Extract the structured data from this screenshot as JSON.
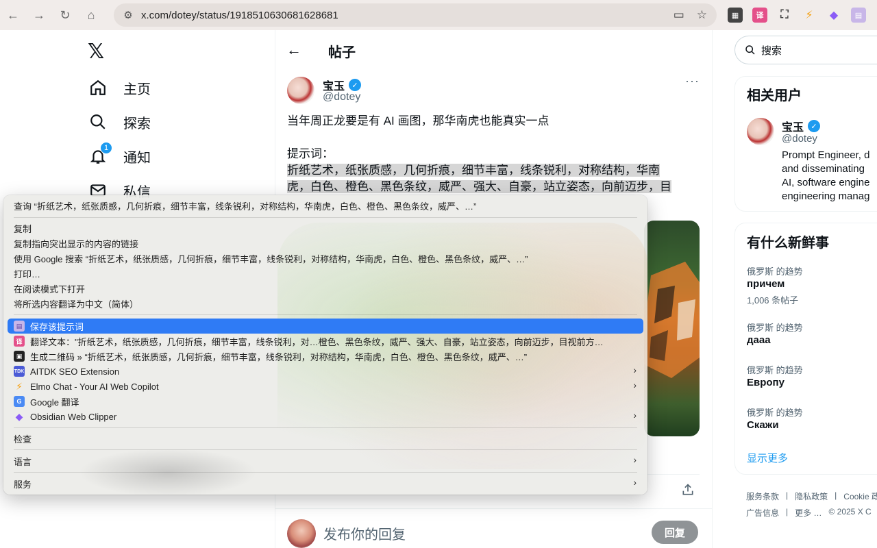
{
  "browser": {
    "url": "x.com/dotey/status/1918510630681628681"
  },
  "left_nav": {
    "items": [
      {
        "label": "主页"
      },
      {
        "label": "探索"
      },
      {
        "label": "通知",
        "badge": "1"
      },
      {
        "label": "私信"
      }
    ]
  },
  "post": {
    "header_title": "帖子",
    "author_name": "宝玉",
    "author_handle": "@dotey",
    "text_line1": "当年周正龙要是有 AI 画图，那华南虎也能真实一点",
    "text_line2": "提示词：",
    "text_highlight1": "折纸艺术，纸张质感，几何折痕，细节丰富，线条锐利，对称结构，华南",
    "text_highlight2": "虎，白色、橙色、黑色条纹，威严、强大、自豪，站立姿态，向前迈步，目",
    "reply_placeholder": "发布你的回复",
    "reply_button": "回复"
  },
  "sidebar": {
    "search_placeholder": "搜索",
    "related_title": "相关用户",
    "related_user": {
      "name": "宝玉",
      "handle": "@dotey",
      "bio": [
        "Prompt Engineer, d",
        "and disseminating",
        "AI, software engine",
        "engineering manag"
      ]
    },
    "trends_title": "有什么新鲜事",
    "trends": [
      {
        "category": "俄罗斯 的趋势",
        "name": "причем",
        "count": "1,006 条帖子"
      },
      {
        "category": "俄罗斯 的趋势",
        "name": "дааа"
      },
      {
        "category": "俄罗斯 的趋势",
        "name": "Европу"
      },
      {
        "category": "俄罗斯 的趋势",
        "name": "Скажи"
      }
    ],
    "show_more": "显示更多",
    "footer_row1": [
      "服务条款",
      "|",
      "隐私政策",
      "|",
      "Cookie 政"
    ],
    "footer_row2": [
      "广告信息",
      "|",
      "更多 …",
      "© 2025 X C"
    ]
  },
  "context_menu": {
    "items": [
      {
        "label": "查询 “折纸艺术，纸张质感，几何折痕，细节丰富，线条锐利，对称结构，华南虎，白色、橙色、黑色条纹，威严、…”"
      },
      {
        "label": "复制"
      },
      {
        "label": "复制指向突出显示的内容的链接"
      },
      {
        "label": "使用 Google 搜索 “折纸艺术，纸张质感，几何折痕，细节丰富，线条锐利，对称结构，华南虎，白色、橙色、黑色条纹，威严、…”"
      },
      {
        "label": "打印…"
      },
      {
        "label": "在阅读模式下打开"
      },
      {
        "label": "将所选内容翻译为中文（简体）"
      },
      {
        "label": "保存该提示词"
      },
      {
        "label": "翻译文本：\"折纸艺术，纸张质感，几何折痕，细节丰富，线条锐利，对…橙色、黑色条纹，威严、强大、自豪，站立姿态，向前迈步，目视前方…"
      },
      {
        "label": "生成二维码 » “折纸艺术，纸张质感，几何折痕，细节丰富，线条锐利，对称结构，华南虎，白色、橙色、黑色条纹，威严、…”"
      },
      {
        "label": "AITDK SEO Extension"
      },
      {
        "label": "Elmo Chat - Your AI Web Copilot"
      },
      {
        "label": "Google 翻译"
      },
      {
        "label": "Obsidian Web Clipper"
      },
      {
        "label": "检查"
      },
      {
        "label": "语言"
      },
      {
        "label": "服务"
      }
    ],
    "icon_labels": {
      "aitdk": "TDK"
    }
  },
  "colors": {
    "accent": "#1d9bf0",
    "menu_highlight": "#2f7bf5"
  }
}
